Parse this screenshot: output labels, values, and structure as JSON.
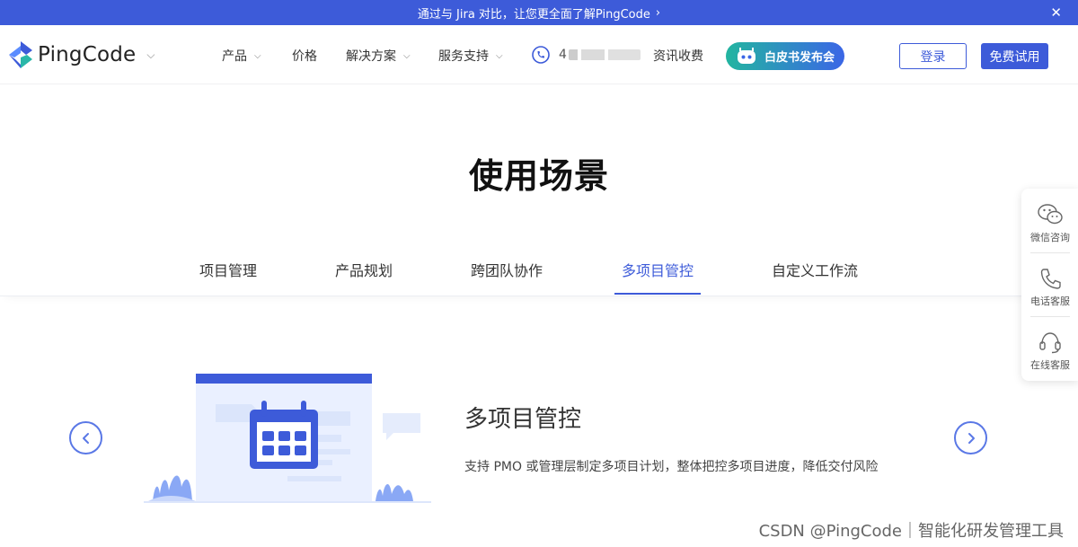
{
  "announcement": {
    "text": "通过与 Jira 对比，让您更全面了解PingCode",
    "chevron": "›",
    "close": "✕"
  },
  "header": {
    "logo_text": "PingCode",
    "nav": [
      "产品",
      "价格",
      "解决方案",
      "服务支持"
    ],
    "phone_number": "4",
    "news": "资讯收费",
    "launch_button": "白皮书发布会",
    "login": "登录",
    "trial": "免费试用"
  },
  "section": {
    "title": "使用场景",
    "tabs": [
      "项目管理",
      "产品规划",
      "跨团队协作",
      "多项目管控",
      "自定义工作流"
    ],
    "active_tab": 3
  },
  "feature": {
    "title": "多项目管控",
    "description": "支持 PMO 或管理层制定多项目计划，整体把控多项目进度，降低交付风险"
  },
  "side_panel": {
    "items": [
      "微信咨询",
      "电话客服",
      "在线客服"
    ]
  },
  "watermark": "CSDN @PingCode｜智能化研发管理工具",
  "colors": {
    "brand": "#3d5bd9",
    "announce_bg": "#3d5bd9",
    "accent_green": "#23b5a0"
  },
  "icons": {
    "close": "close-icon",
    "phone": "phone-icon",
    "wechat": "wechat-icon",
    "headset": "headset-icon",
    "prev": "chevron-left-icon",
    "next": "chevron-right-icon"
  }
}
